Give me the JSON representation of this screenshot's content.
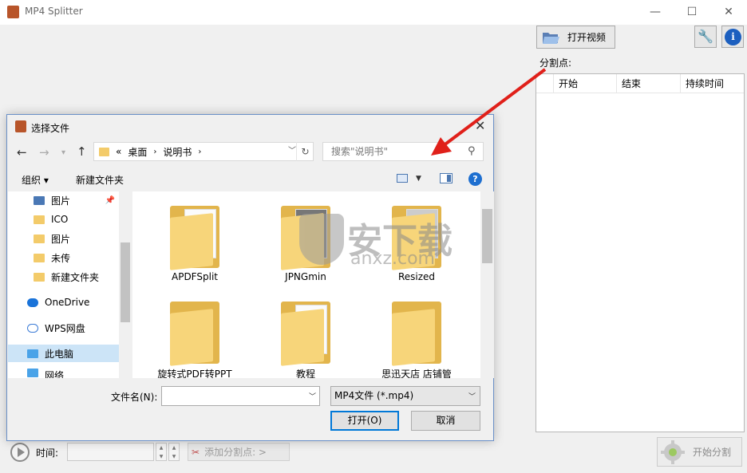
{
  "app": {
    "title": "MP4 Splitter"
  },
  "window_controls": {
    "minimize": "—",
    "maximize": "☐",
    "close": "✕"
  },
  "toolbar": {
    "open_video_label": "打开视频"
  },
  "split": {
    "label": "分割点:",
    "columns": [
      "开始",
      "结束",
      "持续时间"
    ]
  },
  "bottom": {
    "time_label": "时间:",
    "add_split_label": "添加分割点:  >",
    "start_split_label": "开始分割"
  },
  "dialog": {
    "title": "选择文件",
    "breadcrumb": {
      "prefix": "«",
      "parts": [
        "桌面",
        "说明书"
      ]
    },
    "search_placeholder": "搜索\"说明书\"",
    "organize_label": "组织 ▾",
    "new_folder_label": "新建文件夹",
    "help": "?",
    "nav_items": [
      {
        "label": "图片",
        "icon": "pictures-icon"
      },
      {
        "label": "ICO",
        "icon": "folder-icon"
      },
      {
        "label": "图片",
        "icon": "folder-icon"
      },
      {
        "label": "未传",
        "icon": "folder-icon"
      },
      {
        "label": "新建文件夹",
        "icon": "folder-icon"
      },
      {
        "label": "OneDrive",
        "icon": "cloud-icon"
      },
      {
        "label": "WPS网盘",
        "icon": "cloud-icon"
      },
      {
        "label": "此电脑",
        "icon": "computer-icon"
      },
      {
        "label": "网络",
        "icon": "network-icon"
      }
    ],
    "files": [
      "APDFSplit",
      "JPNGmin",
      "Resized",
      "旋转式PDF转PPT",
      "教程",
      "思迅天店 店铺管"
    ],
    "filename_label": "文件名(N):",
    "filename_value": "",
    "filetype_value": "MP4文件 (*.mp4)",
    "open_label": "打开(O)",
    "cancel_label": "取消"
  },
  "watermark": {
    "text": "安下载",
    "url": "anxz.com"
  },
  "colors": {
    "accent": "#0078d7",
    "arrow": "#e0201a",
    "folder": "#f3cb6a"
  }
}
